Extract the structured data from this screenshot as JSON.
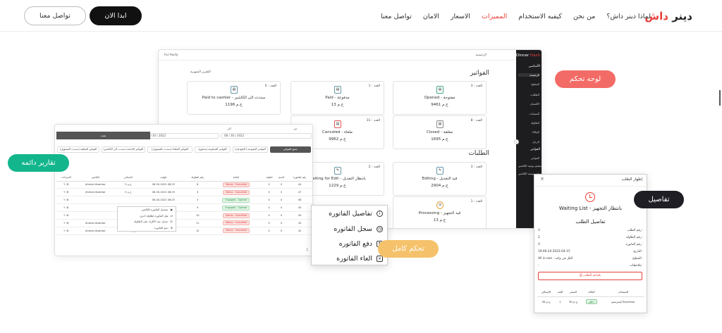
{
  "nav": {
    "logo_main": "دينر",
    "logo_accent": "داش",
    "links": [
      "لماذا دينر داش؟",
      "من نحن",
      "كيفيه الاستخدام",
      "المميزات",
      "الاسعار",
      "الامان",
      "تواصل معنا"
    ],
    "active_index": 3,
    "start_button": "ابدا الان",
    "contact_button": "تواصل معنا"
  },
  "dashboard": {
    "user": "Hu'Awdy",
    "breadcrumb": "الرئيسية",
    "brand_main": "Dinner",
    "brand_accent": "Dash",
    "sidebar_groups": [
      "الأساسي",
      "الفواتير"
    ],
    "sidebar_items": [
      "الرئيسية",
      "المطبخ",
      "الطلبات",
      "الأقسام",
      "المنتجات",
      "الطاولة",
      "الوكلاء",
      "الرجل",
      "الفواتير",
      "تسليم يومية الكاشير",
      "تسليم يومية الكاشير"
    ],
    "invoices_title": "الفواتير",
    "orders_title": "الطلبات",
    "period_label": "التقرير الشهرية",
    "invoice_cards": [
      {
        "count": "العدد : 5",
        "name": "Paid to cashier - سددت الى الكاشير",
        "amount": "1196 ج.م",
        "icon": "doc-icon"
      },
      {
        "count": "العدد : 1",
        "name": "Paid - مدفوعة",
        "amount": "13 ج.م",
        "icon": "doc-icon"
      },
      {
        "count": "العدد : 3",
        "name": "Opened - مفتوحة",
        "amount": "9461 ج.م",
        "icon": "doc-icon"
      },
      {
        "count": "العدد : 31",
        "name": "Canceled - ملغاة",
        "amount": "9962 ج.م",
        "icon": "doc-icon"
      },
      {
        "count": "العدد : 8",
        "name": "Closed - مغلقة",
        "amount": "1695 ج.م",
        "icon": "doc-icon"
      }
    ],
    "order_cards": [
      {
        "count": "العدد : 2",
        "name": "Waiting for Edit - بانتظار التعديل",
        "amount": "1229 ج.م"
      },
      {
        "count": "العدد : 3",
        "name": "Editing - قيد التعديل",
        "amount": "2904 ج.م"
      },
      {
        "count": "العدد : 1",
        "name": "Processing - قيد التجهيز",
        "amount": "13 ج.م"
      }
    ]
  },
  "reports": {
    "from_label": "من",
    "to_label": "الى",
    "date_from": "08 / 30 / 2022",
    "date_to": "08 / 30 / 2022",
    "bar_label": "بحث",
    "filters": [
      "جميع الفواتير",
      "الفواتير المفتوحة (الدفع قيد)",
      "الفواتير المدفوعة (مدفوع)",
      "الفواتير الملغاة (سددت للمسؤول)",
      "الفواتير الناجحة (سددت الى الكاشير)",
      "الفواتير المغلقة (سددت المسؤول)"
    ],
    "columns": [
      "رقم الفاتورة",
      "الاسم",
      "الطلب",
      "الحالة",
      "رقم الطاولة",
      "الوقت",
      "الاجمالي",
      "الكاشير",
      "الاجراءات"
    ],
    "rows": [
      {
        "no": "44",
        "name": "0",
        "order": "0",
        "status": "Status : Cancelled",
        "sg": false,
        "table": "8",
        "time": "06-30-2022 08:25",
        "total": "0 ج.م",
        "cashier": "Ahmed Alashtar"
      },
      {
        "no": "47",
        "name": "0",
        "order": "0",
        "status": "Status : Cancelled",
        "sg": false,
        "table": "4",
        "time": "06-30-2022 08:25",
        "total": "0 ج.م",
        "cashier": "Ahmed Alashtar"
      },
      {
        "no": "46",
        "name": "0",
        "order": "0",
        "status": "Engaged - Opened",
        "sg": true,
        "table": "5",
        "time": "06-30-2022 08:25",
        "total": "",
        "cashier": ""
      },
      {
        "no": "45",
        "name": "0",
        "order": "0",
        "status": "Engaged - Opened",
        "sg": true,
        "table": "9",
        "time": "06-30-2022 08:25",
        "total": "",
        "cashier": ""
      },
      {
        "no": "44",
        "name": "0",
        "order": "0",
        "status": "Status : Cancelled",
        "sg": false,
        "table": "10",
        "time": "06-30-2022 08:25",
        "total": "",
        "cashier": ""
      },
      {
        "no": "43",
        "name": "0",
        "order": "0",
        "status": "Status : Cancelled",
        "sg": false,
        "table": "11",
        "time": "06-30-2022 08:25",
        "total": "1412.9 ج.م",
        "cashier": "Ahmed Alashtar"
      },
      {
        "no": "42",
        "name": "0",
        "order": "0",
        "status": "Status : Cancelled",
        "sg": false,
        "table": "12",
        "time": "06-30-2022 08:25",
        "total": "1061.8 ج.م",
        "cashier": "Ahmed Alashtar"
      }
    ],
    "mini_menu": [
      "تسجيل الفاتورة للكاشير",
      "نقل الفاتورة لطاولة اخرى",
      "تعديل عدد الأفراد على الطاولة",
      "دمج الفاتورة"
    ],
    "pagination": "1"
  },
  "context_menu": {
    "items": [
      {
        "label": "تفاصيل الفاتوره",
        "icon": "info-icon"
      },
      {
        "label": "سجل الفاتوره",
        "icon": "history-icon"
      },
      {
        "label": "دفع الفاتوره",
        "icon": "pay-icon"
      },
      {
        "label": "الغاء الفاتوره",
        "icon": "cancel-icon"
      }
    ]
  },
  "order_panel": {
    "title": "إظهار الطلب",
    "status": "Waiting List - بانتظار التجهيز",
    "details_title": "تفاصيل الطلب",
    "fields": [
      {
        "k": "رقم الطلب:",
        "v": "3"
      },
      {
        "k": "رقم الطاولة:",
        "v": "2"
      },
      {
        "k": "رقم الفاتورة:",
        "v": "3"
      },
      {
        "k": "التاريخ:",
        "v": "19:46:24 2022-04-15"
      },
      {
        "k": "المطبخ:",
        "v": "All in one - الكل في واحد"
      },
      {
        "k": "ملاحظات:",
        "v": "-"
      }
    ],
    "print_label": "طباعة الطلب",
    "columns": [
      "المنتجات",
      "الحالة",
      "السعر",
      "العدد",
      "الإجمالي"
    ],
    "items": [
      {
        "product": "إسبريسو Espresso",
        "status": "جاهز",
        "price": "30 ج.م",
        "qty": "1",
        "total": "30 ج.م"
      }
    ]
  },
  "pills": {
    "dashboard": "لوحه تحكم",
    "reports": "تقارير دائمه",
    "control": "تحكم كامل",
    "details": "تفاصيل"
  },
  "colors": {
    "accent": "#e8403a",
    "coral": "#f36b66",
    "green": "#12b58c",
    "gold": "#f5c26b",
    "dark": "#1e1e24"
  }
}
